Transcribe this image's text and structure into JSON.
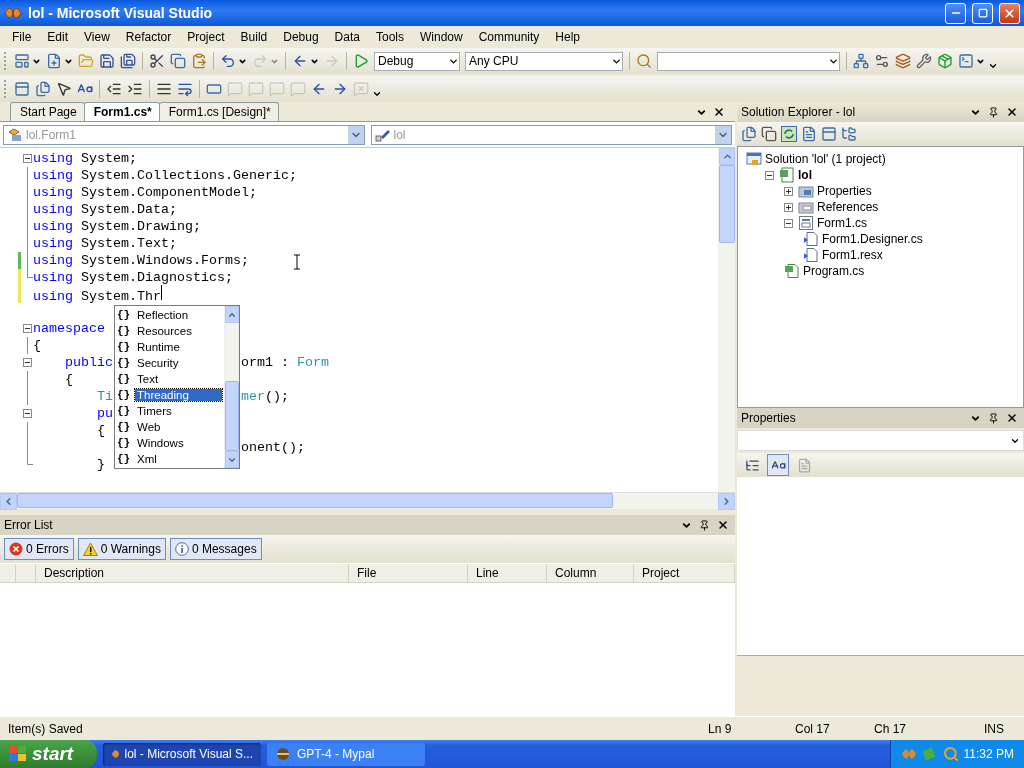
{
  "window": {
    "title": "lol - Microsoft Visual Studio"
  },
  "menu": [
    "File",
    "Edit",
    "View",
    "Refactor",
    "Project",
    "Build",
    "Debug",
    "Data",
    "Tools",
    "Window",
    "Community",
    "Help"
  ],
  "toolbar_1": [
    {
      "kind": "button",
      "dropdown": true,
      "disabled": false
    },
    {
      "kind": "button",
      "dropdown": true,
      "disabled": false
    },
    {
      "kind": "button",
      "dropdown": false,
      "disabled": false
    },
    {
      "kind": "button",
      "dropdown": false,
      "disabled": false
    },
    {
      "kind": "button",
      "dropdown": false,
      "disabled": false
    },
    {
      "kind": "separator"
    },
    {
      "kind": "button",
      "dropdown": false,
      "disabled": false
    },
    {
      "kind": "button",
      "dropdown": false,
      "disabled": false
    },
    {
      "kind": "button",
      "dropdown": false,
      "disabled": false
    },
    {
      "kind": "separator"
    },
    {
      "kind": "button",
      "dropdown": true,
      "disabled": false
    },
    {
      "kind": "button",
      "dropdown": true,
      "disabled": true
    },
    {
      "kind": "separator"
    },
    {
      "kind": "button",
      "dropdown": true,
      "disabled": false
    },
    {
      "kind": "button",
      "dropdown": false,
      "disabled": true
    },
    {
      "kind": "separator"
    },
    {
      "kind": "button",
      "dropdown": false,
      "disabled": false
    },
    {
      "kind": "combo",
      "value": "Debug"
    },
    {
      "kind": "combo",
      "value": "Any CPU"
    },
    {
      "kind": "separator"
    },
    {
      "kind": "button",
      "dropdown": false,
      "disabled": false
    },
    {
      "kind": "combo"
    },
    {
      "kind": "separator"
    },
    {
      "kind": "button",
      "dropdown": false,
      "disabled": false
    },
    {
      "kind": "button",
      "dropdown": false,
      "disabled": false
    },
    {
      "kind": "button",
      "dropdown": false,
      "disabled": false
    },
    {
      "kind": "button",
      "dropdown": false,
      "disabled": false
    },
    {
      "kind": "button",
      "dropdown": false,
      "disabled": false
    },
    {
      "kind": "button",
      "dropdown": true,
      "disabled": false
    }
  ],
  "toolbar_2": [
    {
      "kind": "button",
      "dropdown": false,
      "disabled": false
    },
    {
      "kind": "button",
      "dropdown": false,
      "disabled": false
    },
    {
      "kind": "button",
      "dropdown": false,
      "disabled": false
    },
    {
      "kind": "button",
      "dropdown": false,
      "disabled": false
    },
    {
      "kind": "separator"
    },
    {
      "kind": "button",
      "dropdown": false,
      "disabled": false
    },
    {
      "kind": "button",
      "dropdown": false,
      "disabled": false
    },
    {
      "kind": "separator"
    },
    {
      "kind": "button",
      "dropdown": false,
      "disabled": false
    },
    {
      "kind": "button",
      "dropdown": false,
      "disabled": false
    },
    {
      "kind": "separator"
    },
    {
      "kind": "button",
      "dropdown": false,
      "disabled": false
    },
    {
      "kind": "button",
      "dropdown": false,
      "disabled": true
    },
    {
      "kind": "button",
      "dropdown": false,
      "disabled": true
    },
    {
      "kind": "button",
      "dropdown": false,
      "disabled": true
    },
    {
      "kind": "button",
      "dropdown": false,
      "disabled": true
    },
    {
      "kind": "button",
      "dropdown": false,
      "disabled": false
    },
    {
      "kind": "button",
      "dropdown": false,
      "disabled": false
    },
    {
      "kind": "button",
      "dropdown": false,
      "disabled": true
    }
  ],
  "editor": {
    "tabs": [
      {
        "label": "Start Page",
        "selected": false
      },
      {
        "label": "Form1.cs*",
        "selected": true
      },
      {
        "label": "Form1.cs [Design]*",
        "selected": false
      }
    ],
    "type_selector": "lol.Form1",
    "member_selector": "lol",
    "lines": [
      {
        "collapsible": true,
        "parts": [
          {
            "kind": "keyword",
            "text": "using"
          },
          {
            "kind": "plain",
            "text": " System;"
          }
        ]
      },
      {
        "in_fold": true,
        "parts": [
          {
            "kind": "keyword",
            "text": "using"
          },
          {
            "kind": "plain",
            "text": " System.Collections.Generic;"
          }
        ]
      },
      {
        "in_fold": true,
        "parts": [
          {
            "kind": "keyword",
            "text": "using"
          },
          {
            "kind": "plain",
            "text": " System.ComponentModel;"
          }
        ]
      },
      {
        "in_fold": true,
        "parts": [
          {
            "kind": "keyword",
            "text": "using"
          },
          {
            "kind": "plain",
            "text": " System.Data;"
          }
        ]
      },
      {
        "in_fold": true,
        "parts": [
          {
            "kind": "keyword",
            "text": "using"
          },
          {
            "kind": "plain",
            "text": " System.Drawing;"
          }
        ]
      },
      {
        "in_fold": true,
        "parts": [
          {
            "kind": "keyword",
            "text": "using"
          },
          {
            "kind": "plain",
            "text": " System.Text;"
          }
        ]
      },
      {
        "in_fold": true,
        "modified": true,
        "saved": true,
        "parts": [
          {
            "kind": "keyword",
            "text": "using"
          },
          {
            "kind": "plain",
            "text": " System.Windows.Forms;"
          }
        ]
      },
      {
        "fold_end": true,
        "modified": true,
        "saved": false,
        "parts": [
          {
            "kind": "keyword",
            "text": "using"
          },
          {
            "kind": "plain",
            "text": " System.Diagnostics;"
          }
        ]
      },
      {
        "modified": true,
        "saved": false,
        "caret": true,
        "parts": [
          {
            "kind": "keyword",
            "text": "using"
          },
          {
            "kind": "plain",
            "text": " System.Thr"
          }
        ]
      },
      {
        "collapsible": true,
        "space_before": true,
        "parts": [
          {
            "kind": "keyword",
            "text": "namespace"
          }
        ]
      },
      {
        "in_fold": true,
        "parts": [
          {
            "kind": "plain",
            "text": "{"
          }
        ]
      },
      {
        "collapsible": true,
        "parts": [
          {
            "kind": "keyword",
            "text": "    public"
          }
        ],
        "tail": [
          {
            "kind": "plain",
            "text": "orm1 : "
          },
          {
            "kind": "type",
            "text": "Form"
          }
        ]
      },
      {
        "in_fold": true,
        "parts": [
          {
            "kind": "plain",
            "text": "    {"
          }
        ]
      },
      {
        "in_fold": true,
        "parts": [
          {
            "kind": "type",
            "text": "        Ti"
          }
        ],
        "tail": [
          {
            "kind": "type",
            "text": "mer"
          },
          {
            "kind": "plain",
            "text": "();"
          }
        ]
      },
      {
        "collapsible": true,
        "parts": [
          {
            "kind": "keyword",
            "text": "        pu"
          }
        ]
      },
      {
        "in_fold": true,
        "parts": [
          {
            "kind": "plain",
            "text": "        {"
          }
        ]
      },
      {
        "in_fold": true,
        "tail": [
          {
            "kind": "plain",
            "text": "onent();"
          }
        ]
      },
      {
        "fold_end": true,
        "parts": [
          {
            "kind": "plain",
            "text": "        }"
          }
        ]
      }
    ],
    "completion": [
      {
        "glyph": "{}",
        "label": "Reflection",
        "selected": false
      },
      {
        "glyph": "{}",
        "label": "Resources",
        "selected": false
      },
      {
        "glyph": "{}",
        "label": "Runtime",
        "selected": false
      },
      {
        "glyph": "{}",
        "label": "Security",
        "selected": false
      },
      {
        "glyph": "{}",
        "label": "Text",
        "selected": false
      },
      {
        "glyph": "{}",
        "label": "Threading",
        "selected": true
      },
      {
        "glyph": "{}",
        "label": "Timers",
        "selected": false
      },
      {
        "glyph": "{}",
        "label": "Web",
        "selected": false
      },
      {
        "glyph": "{}",
        "label": "Windows",
        "selected": false
      },
      {
        "glyph": "{}",
        "label": "Xml",
        "selected": false
      }
    ]
  },
  "error_list": {
    "title": "Error List",
    "filters": [
      {
        "kind": "error",
        "label": "0 Errors",
        "selected": true
      },
      {
        "kind": "warning",
        "label": "0 Warnings",
        "selected": true
      },
      {
        "kind": "info",
        "label": "0 Messages",
        "selected": true
      }
    ],
    "columns": [
      "Description",
      "File",
      "Line",
      "Column",
      "Project"
    ]
  },
  "solution_explorer": {
    "title": "Solution Explorer - lol",
    "tree": [
      {
        "kind": "solution",
        "label": "Solution 'lol' (1 project)",
        "children": [
          {
            "kind": "project",
            "label": "lol",
            "startup": true,
            "expanded": true,
            "children": [
              {
                "kind": "properties",
                "label": "Properties",
                "expanded": false
              },
              {
                "kind": "references",
                "label": "References",
                "expanded": false
              },
              {
                "kind": "form",
                "label": "Form1.cs",
                "expanded": true,
                "children": [
                  {
                    "kind": "dependent",
                    "label": "Form1.Designer.cs"
                  },
                  {
                    "kind": "dependent",
                    "label": "Form1.resx"
                  }
                ]
              },
              {
                "kind": "csharp",
                "label": "Program.cs"
              }
            ]
          }
        ]
      }
    ]
  },
  "properties": {
    "title": "Properties",
    "buttons": [
      {
        "kind": "categorized",
        "selected": false,
        "disabled": false
      },
      {
        "kind": "alphabetical",
        "selected": true,
        "disabled": false
      },
      {
        "kind": "pages",
        "selected": false,
        "disabled": true
      }
    ]
  },
  "status_bar": {
    "message": "Item(s) Saved",
    "line": "Ln 9",
    "column": "Col 17",
    "char": "Ch 17",
    "mode": "INS"
  },
  "taskbar": {
    "start": "start",
    "tasks": [
      {
        "kind": "studio",
        "label": "lol - Microsoft Visual S...",
        "selected": true
      },
      {
        "kind": "browser",
        "label": "GPT-4 - Mypal",
        "selected": false
      }
    ],
    "clock": "11:32 PM"
  }
}
